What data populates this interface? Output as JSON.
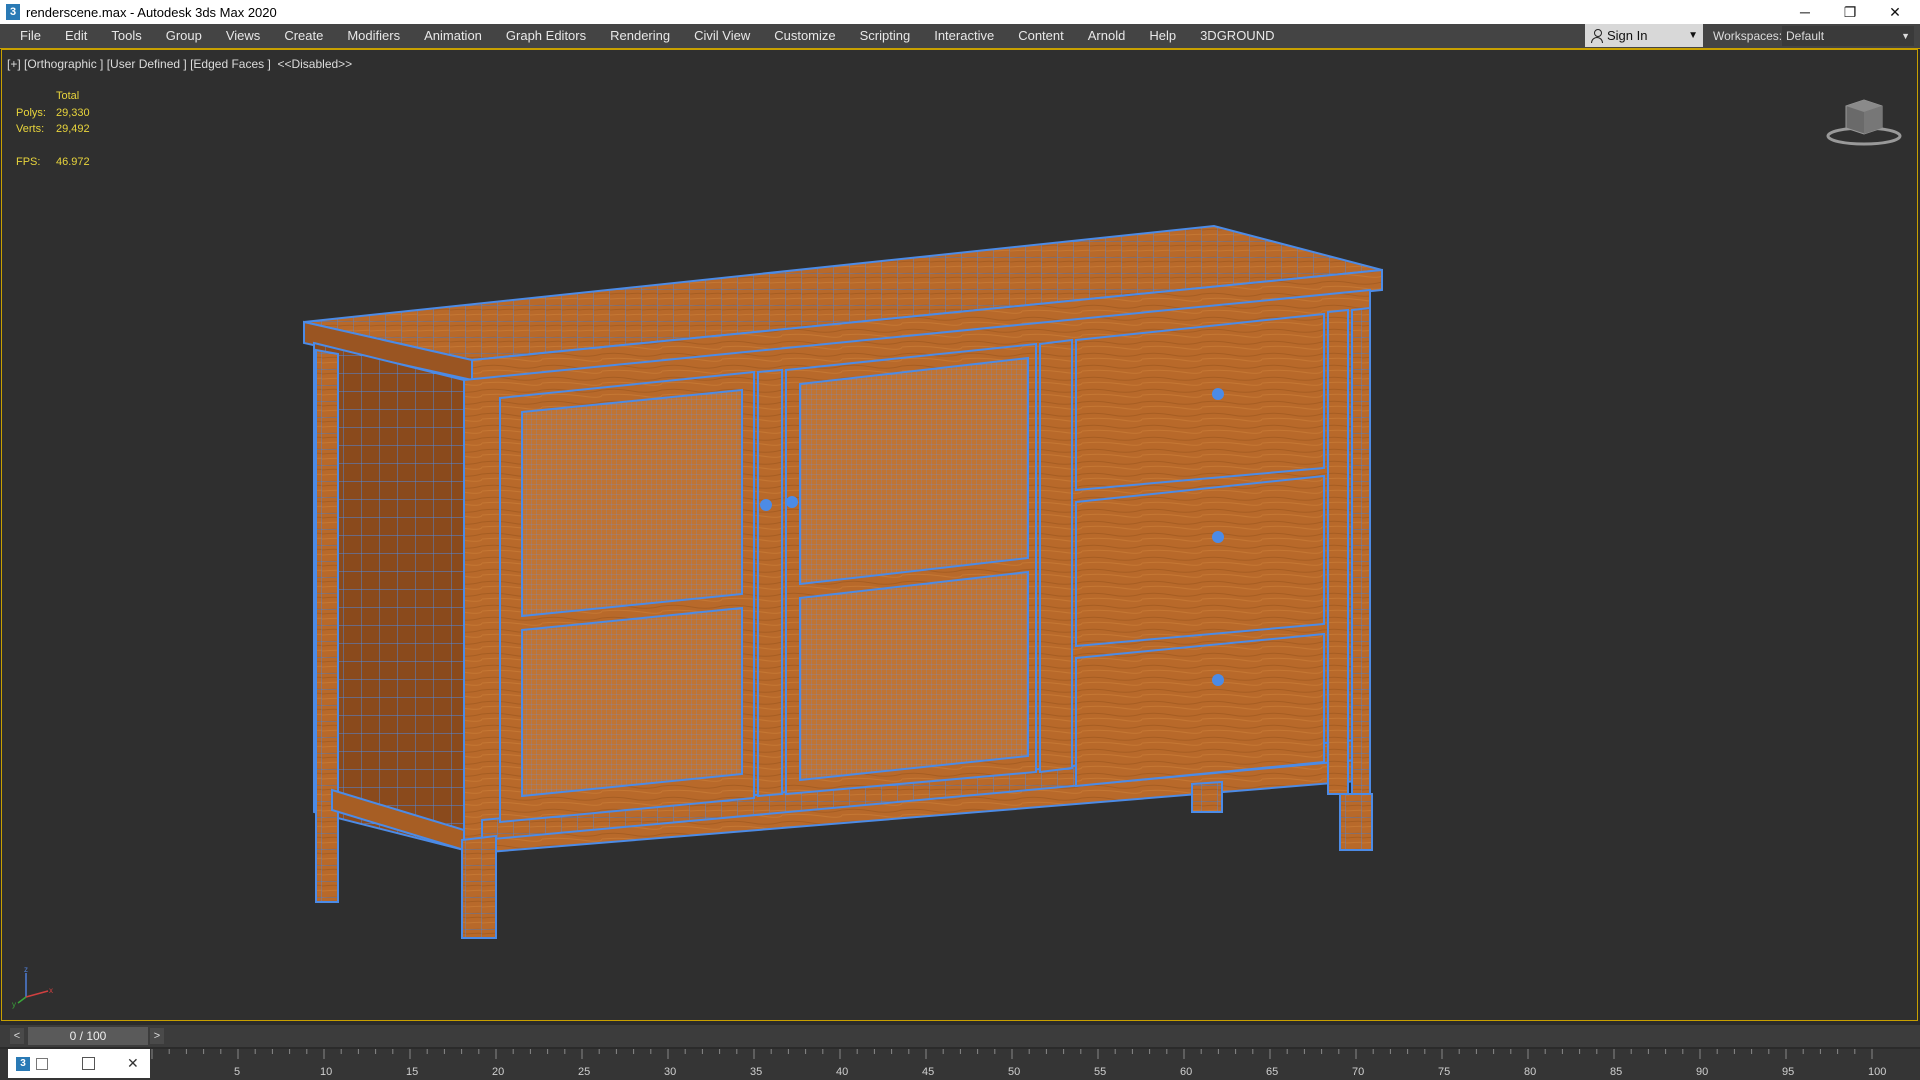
{
  "window": {
    "title": "renderscene.max - Autodesk 3ds Max 2020",
    "app_icon_glyph": "3",
    "controls": {
      "minimize": "─",
      "restore": "❐",
      "close": "✕"
    }
  },
  "menubar": {
    "items": [
      "File",
      "Edit",
      "Tools",
      "Group",
      "Views",
      "Create",
      "Modifiers",
      "Animation",
      "Graph Editors",
      "Rendering",
      "Civil View",
      "Customize",
      "Scripting",
      "Interactive",
      "Content",
      "Arnold",
      "Help",
      "3DGROUND"
    ],
    "signin_label": "Sign In",
    "workspaces_label": "Workspaces:",
    "workspace_value": "Default"
  },
  "viewport": {
    "label": "[+] [Orthographic ] [User Defined ] [Edged Faces ]  <<Disabled>>",
    "stats": {
      "header": "Total",
      "polys_label": "Polys:",
      "polys_value": "29,330",
      "verts_label": "Verts:",
      "verts_value": "29,492",
      "fps_label": "FPS:",
      "fps_value": "46.972"
    },
    "viewcube_icon": "viewcube-icon",
    "axis_labels": {
      "y": "y",
      "x": "x",
      "z": "z"
    },
    "colors": {
      "wood": "#b8692a",
      "wireframe": "#4c8be6",
      "background": "#2f2f2f",
      "active_border": "#c8a000"
    }
  },
  "timeline": {
    "prev": "<",
    "next": ">",
    "frame": "0 / 100",
    "ruler_labels": [
      "5",
      "10",
      "15",
      "20",
      "25",
      "30",
      "35",
      "40",
      "45",
      "50",
      "55",
      "60",
      "65",
      "70",
      "75",
      "80",
      "85",
      "90",
      "95",
      "100"
    ]
  },
  "mini_listener": {
    "icon_glyph": "3"
  }
}
